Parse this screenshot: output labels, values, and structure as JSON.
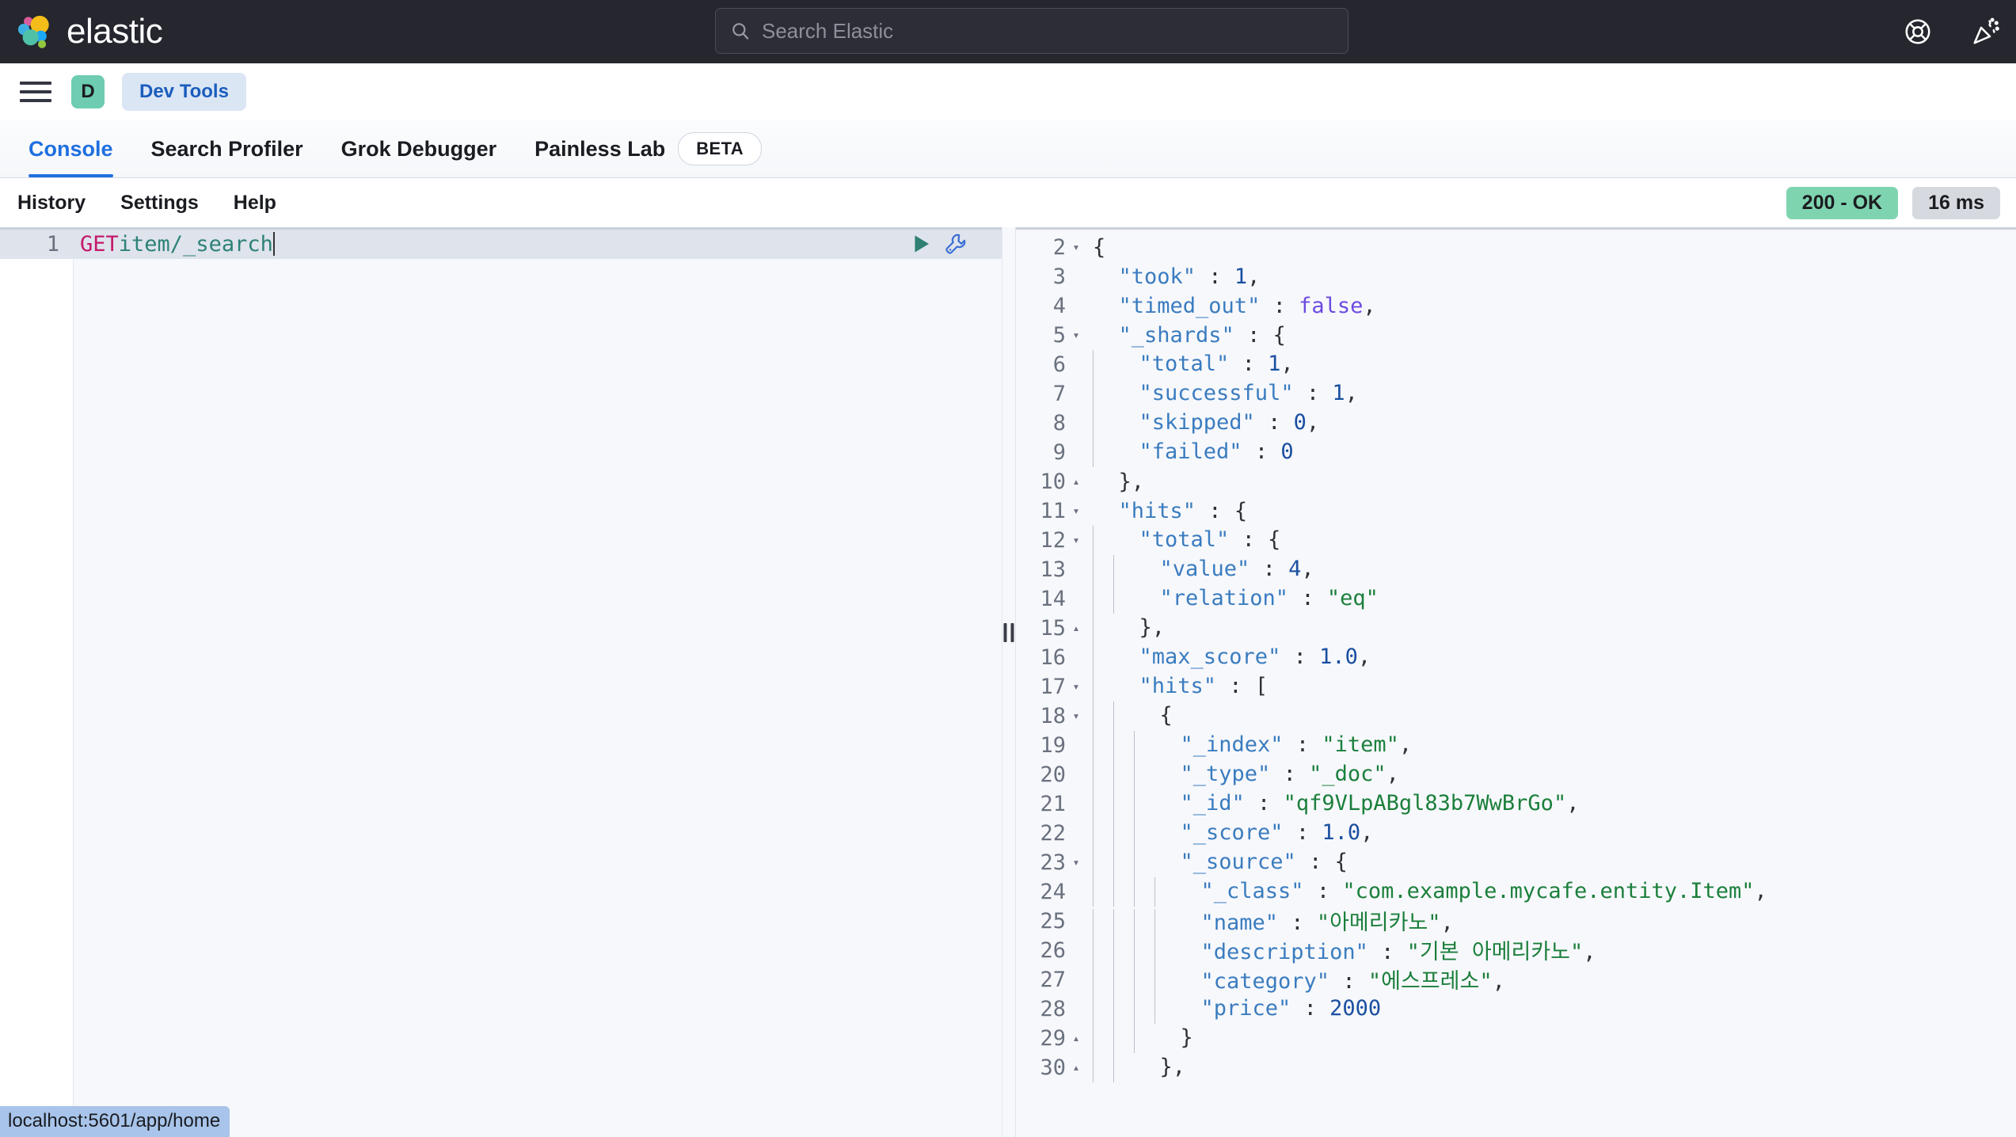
{
  "header": {
    "brand_name": "elastic",
    "logo_icon": "elastic-logo",
    "search": {
      "placeholder": "Search Elastic",
      "value": "",
      "icon": "search-icon"
    },
    "actions": [
      {
        "icon": "help-lifebuoy-icon",
        "label": "Help"
      },
      {
        "icon": "cheer-announcement-icon",
        "label": "What's new"
      }
    ]
  },
  "breadcrumb": {
    "menu_icon": "hamburger-menu-icon",
    "space_avatar": "D",
    "items": [
      {
        "label": "Dev Tools"
      }
    ]
  },
  "tabs": [
    {
      "label": "Console",
      "active": true,
      "badge": ""
    },
    {
      "label": "Search Profiler",
      "active": false,
      "badge": ""
    },
    {
      "label": "Grok Debugger",
      "active": false,
      "badge": ""
    },
    {
      "label": "Painless Lab",
      "active": false,
      "badge": "BETA"
    }
  ],
  "toolbar": {
    "links": [
      {
        "label": "History"
      },
      {
        "label": "Settings"
      },
      {
        "label": "Help"
      }
    ],
    "status_code": "200 - OK",
    "duration": "16 ms",
    "status_color": "#7fd4b0"
  },
  "request_editor": {
    "line_number": "1",
    "method": "GET",
    "path": "item/_search",
    "play_icon": "play-send-request-icon",
    "wrench_icon": "wrench-context-menu-icon"
  },
  "splitter": {
    "grip_icon": "drag-handle-icon"
  },
  "response_editor": {
    "lines": [
      {
        "num": "2",
        "fold": "open",
        "indent": 0,
        "tokens": [
          {
            "t": "p",
            "v": "{"
          }
        ]
      },
      {
        "num": "3",
        "fold": "",
        "indent": 0,
        "tokens": [
          {
            "t": "k",
            "v": "  \"took\""
          },
          {
            "t": "p",
            "v": " : "
          },
          {
            "t": "n",
            "v": "1"
          },
          {
            "t": "p",
            "v": ","
          }
        ]
      },
      {
        "num": "4",
        "fold": "",
        "indent": 0,
        "tokens": [
          {
            "t": "k",
            "v": "  \"timed_out\""
          },
          {
            "t": "p",
            "v": " : "
          },
          {
            "t": "b",
            "v": "false"
          },
          {
            "t": "p",
            "v": ","
          }
        ]
      },
      {
        "num": "5",
        "fold": "open",
        "indent": 0,
        "tokens": [
          {
            "t": "k",
            "v": "  \"_shards\""
          },
          {
            "t": "p",
            "v": " : {"
          }
        ]
      },
      {
        "num": "6",
        "fold": "",
        "indent": 1,
        "tokens": [
          {
            "t": "k",
            "v": "  \"total\""
          },
          {
            "t": "p",
            "v": " : "
          },
          {
            "t": "n",
            "v": "1"
          },
          {
            "t": "p",
            "v": ","
          }
        ]
      },
      {
        "num": "7",
        "fold": "",
        "indent": 1,
        "tokens": [
          {
            "t": "k",
            "v": "  \"successful\""
          },
          {
            "t": "p",
            "v": " : "
          },
          {
            "t": "n",
            "v": "1"
          },
          {
            "t": "p",
            "v": ","
          }
        ]
      },
      {
        "num": "8",
        "fold": "",
        "indent": 1,
        "tokens": [
          {
            "t": "k",
            "v": "  \"skipped\""
          },
          {
            "t": "p",
            "v": " : "
          },
          {
            "t": "n",
            "v": "0"
          },
          {
            "t": "p",
            "v": ","
          }
        ]
      },
      {
        "num": "9",
        "fold": "",
        "indent": 1,
        "tokens": [
          {
            "t": "k",
            "v": "  \"failed\""
          },
          {
            "t": "p",
            "v": " : "
          },
          {
            "t": "n",
            "v": "0"
          }
        ]
      },
      {
        "num": "10",
        "fold": "close",
        "indent": 0,
        "tokens": [
          {
            "t": "p",
            "v": "  },"
          }
        ]
      },
      {
        "num": "11",
        "fold": "open",
        "indent": 0,
        "tokens": [
          {
            "t": "k",
            "v": "  \"hits\""
          },
          {
            "t": "p",
            "v": " : {"
          }
        ]
      },
      {
        "num": "12",
        "fold": "open",
        "indent": 1,
        "tokens": [
          {
            "t": "k",
            "v": "  \"total\""
          },
          {
            "t": "p",
            "v": " : {"
          }
        ]
      },
      {
        "num": "13",
        "fold": "",
        "indent": 2,
        "tokens": [
          {
            "t": "k",
            "v": "  \"value\""
          },
          {
            "t": "p",
            "v": " : "
          },
          {
            "t": "n",
            "v": "4"
          },
          {
            "t": "p",
            "v": ","
          }
        ]
      },
      {
        "num": "14",
        "fold": "",
        "indent": 2,
        "tokens": [
          {
            "t": "k",
            "v": "  \"relation\""
          },
          {
            "t": "p",
            "v": " : "
          },
          {
            "t": "s",
            "v": "\"eq\""
          }
        ]
      },
      {
        "num": "15",
        "fold": "close",
        "indent": 1,
        "tokens": [
          {
            "t": "p",
            "v": "  },"
          }
        ]
      },
      {
        "num": "16",
        "fold": "",
        "indent": 1,
        "tokens": [
          {
            "t": "k",
            "v": "  \"max_score\""
          },
          {
            "t": "p",
            "v": " : "
          },
          {
            "t": "n",
            "v": "1.0"
          },
          {
            "t": "p",
            "v": ","
          }
        ]
      },
      {
        "num": "17",
        "fold": "open",
        "indent": 1,
        "tokens": [
          {
            "t": "k",
            "v": "  \"hits\""
          },
          {
            "t": "p",
            "v": " : ["
          }
        ]
      },
      {
        "num": "18",
        "fold": "open",
        "indent": 2,
        "tokens": [
          {
            "t": "p",
            "v": "  {"
          }
        ]
      },
      {
        "num": "19",
        "fold": "",
        "indent": 3,
        "tokens": [
          {
            "t": "k",
            "v": "  \"_index\""
          },
          {
            "t": "p",
            "v": " : "
          },
          {
            "t": "s",
            "v": "\"item\""
          },
          {
            "t": "p",
            "v": ","
          }
        ]
      },
      {
        "num": "20",
        "fold": "",
        "indent": 3,
        "tokens": [
          {
            "t": "k",
            "v": "  \"_type\""
          },
          {
            "t": "p",
            "v": " : "
          },
          {
            "t": "s",
            "v": "\"_doc\""
          },
          {
            "t": "p",
            "v": ","
          }
        ]
      },
      {
        "num": "21",
        "fold": "",
        "indent": 3,
        "tokens": [
          {
            "t": "k",
            "v": "  \"_id\""
          },
          {
            "t": "p",
            "v": " : "
          },
          {
            "t": "s",
            "v": "\"qf9VLpABgl83b7WwBrGo\""
          },
          {
            "t": "p",
            "v": ","
          }
        ]
      },
      {
        "num": "22",
        "fold": "",
        "indent": 3,
        "tokens": [
          {
            "t": "k",
            "v": "  \"_score\""
          },
          {
            "t": "p",
            "v": " : "
          },
          {
            "t": "n",
            "v": "1.0"
          },
          {
            "t": "p",
            "v": ","
          }
        ]
      },
      {
        "num": "23",
        "fold": "open",
        "indent": 3,
        "tokens": [
          {
            "t": "k",
            "v": "  \"_source\""
          },
          {
            "t": "p",
            "v": " : {"
          }
        ]
      },
      {
        "num": "24",
        "fold": "",
        "indent": 4,
        "tokens": [
          {
            "t": "k",
            "v": "  \"_class\""
          },
          {
            "t": "p",
            "v": " : "
          },
          {
            "t": "s",
            "v": "\"com.example.mycafe.entity.Item\""
          },
          {
            "t": "p",
            "v": ","
          }
        ]
      },
      {
        "num": "25",
        "fold": "",
        "indent": 4,
        "tokens": [
          {
            "t": "k",
            "v": "  \"name\""
          },
          {
            "t": "p",
            "v": " : "
          },
          {
            "t": "s",
            "v": "\"아메리카노\""
          },
          {
            "t": "p",
            "v": ","
          }
        ]
      },
      {
        "num": "26",
        "fold": "",
        "indent": 4,
        "tokens": [
          {
            "t": "k",
            "v": "  \"description\""
          },
          {
            "t": "p",
            "v": " : "
          },
          {
            "t": "s",
            "v": "\"기본 아메리카노\""
          },
          {
            "t": "p",
            "v": ","
          }
        ]
      },
      {
        "num": "27",
        "fold": "",
        "indent": 4,
        "tokens": [
          {
            "t": "k",
            "v": "  \"category\""
          },
          {
            "t": "p",
            "v": " : "
          },
          {
            "t": "s",
            "v": "\"에스프레소\""
          },
          {
            "t": "p",
            "v": ","
          }
        ]
      },
      {
        "num": "28",
        "fold": "",
        "indent": 4,
        "tokens": [
          {
            "t": "k",
            "v": "  \"price\""
          },
          {
            "t": "p",
            "v": " : "
          },
          {
            "t": "n",
            "v": "2000"
          }
        ]
      },
      {
        "num": "29",
        "fold": "close",
        "indent": 3,
        "tokens": [
          {
            "t": "p",
            "v": "  }"
          }
        ]
      },
      {
        "num": "30",
        "fold": "close",
        "indent": 2,
        "tokens": [
          {
            "t": "p",
            "v": "  },"
          }
        ]
      }
    ]
  },
  "status_bar": {
    "link_url": "localhost:5601/app/home"
  }
}
